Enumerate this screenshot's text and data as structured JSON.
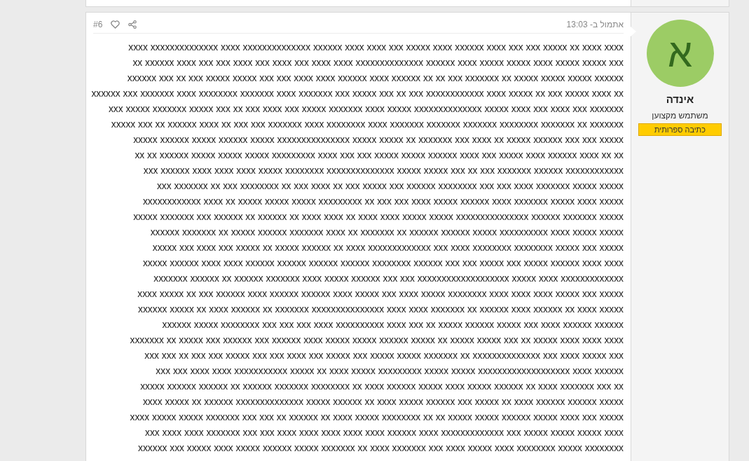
{
  "post": {
    "number": "#6",
    "time": "אתמול ב- 13:03",
    "body_lines": [
      "xxxx xxxxxxxxxxxxxx xxxx xxxxxxxxxxxxxx xxxxxx xxxx xxxx xxx xxxxx xxxx xxxxxx xxxx xxx xxx xxxxx xx xxxx xxxx",
      "xx xxxxxx xxxx xxx xxx xxxx xxx xxxx xxx xxxx xxxx xxxxxxxxxxxxxx xxxxxx xxxx xxxxx xxxxx xxxx xxxxx xxxxx xxx",
      "xxxxxx xxx xx xxx xxxxx xxxxx xxx xxx xxxx xxxx xxxxxx xxxx xxxxxx xx xx xxx xxxxxxx xx xxxxx xxxxx xxxxx xxxxxx",
      "xxxxxx xxx xxxxxxx xxxx xxxxxxxx xxxxxxx xxxx xxxxxxx xxx xxxxx xxx xx xxx xxxxxxxxxxxx xxxx xxxxx xx xxx xxxxx xxxx xx",
      "xxx xxxxx xxxxxxx xxxxx xxx xx xxx xxxx xxx xxxxx xxxxxxx xxxx xxxxx xxxxxxxxxxxxxx xxxxx xxxx xxx xxxx xxx xxxxxxx",
      "xxxxx xxx xx xxxxxx xxxx xx xxx xxx xxxxxxx xxxx xxxxxxxx xxxx xxxxxxx xxxxxxx xxxxxxx xxxxxxxx xxxxxxx xx xxxxxxx",
      "xxxxx xxxxxx xxxxx xxxxxx xxxxx xxxxxxxxxxxxxxx xxxxx xxxxx xx xxxxxxx xxx xxxx xx xxxxx xxxxxx xxx xxx xxxxx",
      "xx xx xxxxxx xxxxx xxxxx xxxxx xxxxxxxxx xxxx xxx xxx xxxxx xxxxx xxxxxx xxxx xxx xxxxx xxxx xxxxxx xxxx xx xx",
      "xxx xxxxxx xxxx xxxx xxxx xxxxx xxxxxxxx xxxxxxxxxxxxxx xxxxx xxxxx xxx xx xxx xxxxxxx xxxxxx xxxxxxxxxxxx",
      "xxx xxxxxxx xx xxx xxxxxxxx xx xxx xxxx xx xxx xxxxx xxx xxxxxx xxxxxxxx xxx xxx xxxx xxxxxxx xxxxx xxxxx",
      "xxxxxxxxxxxx xxxx xx xxxxx xxxxx xxxxx xxxxxxxxx xx xxx xxx xxxx xxxxx xxxxxx xxxx xxxxxxx xxxxx xxxx xxxxx",
      "xxxxx xxxxxxx xxx xxxxxx xx xxxxxx xx xxxx xxxx xx xxxx xxxx xxxxx xxxxx xxxxxxxxxxxxxxx xxxxxx xxxxxxx xxxxx",
      "xxxxxx xxxxxxx xx xxxxx xxxxxx xxxxxxx xxxx xx xxxxxxx xx xxxxxx xxxxxx xxxxx xxxxxxxxxx xxxx xxxxx xxxxx",
      "xxxxx xxx xxxx xxx xxxxx xx xxxxx xxxxxx xx xxxx xxxxxxxxxxxxx xxx xxxx xxxxxxxx xxxxxxxx xxxxx xxx xxxxx",
      "xxxxx xxxxxx xxxx xxxx xxxxxx xxxxxx xxxxxx xxxxxx xxxxxxxx xxxxxx xxx xxx xxxxx xxx xxxxx xxxxxx xxxx xxxx",
      "xxxxxxx xxxxxx xx xxxxxx xxxxxxx xxxx xxxxx xxxxxx xxx xxx xxxxxxxxxxxxxxxxxxx xxxxx xxxx xxxxxxxxxxxxx",
      "xxxx xxxxx xx xxx xxxxxx xxxx xxxxxx xxxxxx xxxx xxxxx xxx xxxx xxxxx xxxxxxxx xxxx xxxx xxxx xxxxx xxx xxxxx",
      "xxxxxx xxxxx xx xxxx xxxxxx xx xxxxxxx xxxxxxxxxxxxxxx xxxx xxxx xxxxxxx xx xxxxxx xxxx xxxxxx xx xxxx xxxxx",
      "xxxxxx xxxxx xxxxxxxx xxx xxx xxx xxxx xxxxxxxxxx xxxx xxx xx xxxxx xxxxxx xxxxx xxx xxxx xxxxxx xxxxxx",
      "xxxxxxx xx xxxxx xxx xxxxxx xxx xxxxxx xxxx xxxxx xxxxx xxxxxx xxxxx xx xxxxx xxxxx xxx xx xxxxx xxxx xxxx xxxx",
      "xxx xxx xx xxx xxx xxxxx xxx xxx xxxx xxx xxxxx xxx xxxxx xxxxx xxxxxxx xx xxxxxxxxxxxxxx xxx xxxx xxxxx xxx",
      "xxx xxx xxxx xxxx xxxxxxxxxxx xxxxx xx xxxx xxxxx xxxxxxxxx xxxxx xxxxx xxxxxxxxxxxxxxxxxxx xxxx xxxxxx",
      "xxxxx xxxxxx xxxxxx xx xxxxxx xxxxxxx xxxxxxxx xx xxxx xxxxxx xxxxx xxxx xxxxx xxxxxx xx xxxx xxxxxxx xxx xx",
      "xxxx xxxxx xx xxxxxx xxxxxxxxxxxxxx xxxxx xxxxxx xx xxxx xxxxx xxxxxx xxx xxxxx xx xxxx xxxxxx xxxxxx xxxxx",
      "xxxx xxxxx xxxxx xxxxxxx xxx xxx xx xxxxxx xx xxxx xxxxx xxxxxxxx xx xx xxxxx xxxxx xxxxxx xxxxx xxxx xxx xxxxx",
      "xxx xxxx xxxx xxxxxxx xxx xxx xxxx xxxx xxxx xxxx xxxx xxxxxx xxxx xxxxxxxxxxxxx xxx xxxxx xxxxx xxxxx xxxx",
      "xxxxxx xxx xxxxx xxxx xxxxx xxxxxx xxxxx xxxxxxx xx xxxx xxxxxxx xxx xxxx xxxxx xxxx xxxxxxxx xxxxx xxxxxxxx"
    ],
    "author": {
      "avatar_letter": "א",
      "name": "אינדה",
      "title": "משתמש מקצוען",
      "badge": "כתיבה ספרותית"
    }
  }
}
